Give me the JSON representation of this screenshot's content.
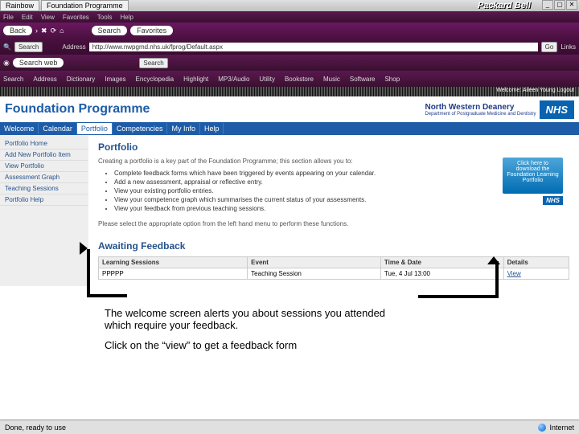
{
  "window": {
    "tab1": "Rainbow",
    "tab2": "Foundation Programme",
    "brand": "Packard Bell"
  },
  "menubar": [
    "File",
    "Edit",
    "View",
    "Favorites",
    "Tools",
    "Help"
  ],
  "tb1": {
    "back": "Back",
    "search": "Search",
    "fav": "Favorites"
  },
  "tb2": {
    "searchbtn": "Search",
    "addrlabel": "Address",
    "url": "http://www.nwpgmd.nhs.uk/fprog/Default.aspx",
    "go": "Go",
    "links": "Links"
  },
  "tb3": {
    "searchweb": "Search web",
    "search": "Search"
  },
  "tb4": {
    "items": [
      "Search",
      "Address",
      "Dictionary",
      "Images",
      "Encyclopedia",
      "Highlight",
      "MP3/Audio",
      "Utility",
      "Bookstore",
      "Music",
      "Software",
      "Shop"
    ]
  },
  "welcomebar": "Welcome: Aileen Young   Logout",
  "header": {
    "title": "Foundation Programme",
    "deanery": "North Western Deanery",
    "sub": "Department of Postgraduate Medicine and Dentistry",
    "nhs": "NHS"
  },
  "tabs": [
    "Welcome",
    "Calendar",
    "Portfolio",
    "Competencies",
    "My Info",
    "Help"
  ],
  "sidebar": [
    {
      "label": "Portfolio Home"
    },
    {
      "label": "Add New Portfolio Item"
    },
    {
      "label": "View Portfolio"
    },
    {
      "label": "Assessment Graph"
    },
    {
      "label": "Teaching Sessions"
    },
    {
      "label": "Portfolio Help"
    }
  ],
  "main": {
    "title": "Portfolio",
    "intro": "Creating a portfolio is a key part of the Foundation Programme; this section allows you to:",
    "bullets": [
      "Complete feedback forms which have been triggered by events appearing on your calendar.",
      "Add a new assessment, appraisal or reflective entry.",
      "View your existing portfolio entries.",
      "View your competence graph which summarises the current status of your assessments.",
      "View your feedback from previous teaching sessions."
    ],
    "after": "Please select the appropriate option from the left hand menu to perform these functions.",
    "cta": "Click here to download the Foundation Learning Portfolio",
    "nhs": "NHS"
  },
  "awaiting": {
    "title": "Awaiting Feedback",
    "cols": [
      "Learning Sessions",
      "Event",
      "Time & Date",
      "Details"
    ],
    "row": {
      "c0": "PPPPP",
      "c1": "Teaching Session",
      "c2": "Tue, 4 Jul 13:00",
      "c3": "View"
    }
  },
  "callout": {
    "l1": "The welcome screen alerts you about sessions you attended which require your feedback.",
    "l2": "Click on the “view” to get a feedback form"
  },
  "status": {
    "left": "Done, ready to use",
    "right": "Internet"
  }
}
